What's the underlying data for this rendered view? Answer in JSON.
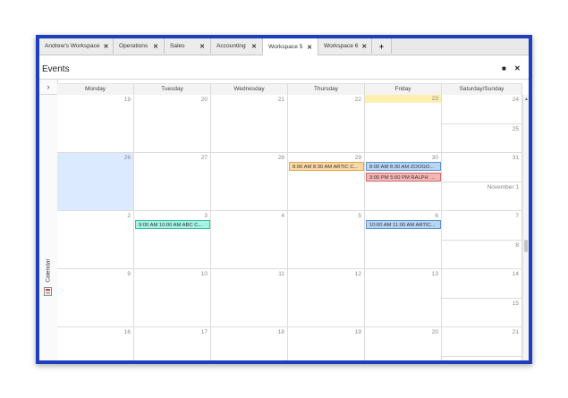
{
  "tabs": [
    {
      "label": "Andrew's Workspace",
      "width": 83,
      "active": false
    },
    {
      "label": "Operations",
      "width": 57,
      "active": false
    },
    {
      "label": "Sales",
      "width": 52,
      "active": false
    },
    {
      "label": "Accounting",
      "width": 58,
      "active": false
    },
    {
      "label": "Workspace 5",
      "width": 62,
      "active": true
    },
    {
      "label": "Workspace 6",
      "width": 60,
      "active": false
    }
  ],
  "add_tab_label": "+",
  "close_glyph": "✕",
  "panel": {
    "title": "Events",
    "restore_glyph": "■",
    "close_glyph": "✕"
  },
  "sidebar": {
    "expand_glyph": "›",
    "label": "Calendar"
  },
  "weekdays": [
    "Monday",
    "Tuesday",
    "Wednesday",
    "Thursday",
    "Friday",
    "Saturday/Sunday"
  ],
  "weeks": [
    {
      "days": [
        "19",
        "20",
        "21",
        "22",
        "23"
      ],
      "sat": "24",
      "sun": "25"
    },
    {
      "days": [
        "26",
        "27",
        "28",
        "29",
        "30"
      ],
      "sat": "31",
      "sun": "November 1"
    },
    {
      "days": [
        "2",
        "3",
        "4",
        "5",
        "6"
      ],
      "sat": "7",
      "sun": "8"
    },
    {
      "days": [
        "9",
        "10",
        "11",
        "12",
        "13"
      ],
      "sat": "14",
      "sun": "15"
    },
    {
      "days": [
        "16",
        "17",
        "18",
        "19",
        "20"
      ],
      "sat": "21",
      "sun": ""
    }
  ],
  "today": {
    "week": 0,
    "day": 4
  },
  "selected": {
    "week": 1,
    "day": 0
  },
  "events": [
    {
      "week": 1,
      "day": 3,
      "slot": 0,
      "text": "8:00 AM  8:30 AM ARTIC C...",
      "bg": "#fcd9a6",
      "border": "#e3a44f"
    },
    {
      "week": 1,
      "day": 4,
      "slot": 0,
      "text": "8:00 AM  8:30 AM ZOOGO...",
      "bg": "#b7d6f5",
      "border": "#5c93cf"
    },
    {
      "week": 1,
      "day": 4,
      "slot": 1,
      "text": "3:00 PM  5:00 PM RALPH M...",
      "bg": "#f5b6b6",
      "border": "#d46a6a"
    },
    {
      "week": 2,
      "day": 1,
      "slot": 0,
      "text": "9:00 AM  10:00 AM ABC C...",
      "bg": "#a5f3e2",
      "border": "#3dbf9f"
    },
    {
      "week": 2,
      "day": 4,
      "slot": 0,
      "text": "10:00 AM  11:00 AM ARTIC...",
      "bg": "#b7d6f5",
      "border": "#5c93cf"
    }
  ]
}
